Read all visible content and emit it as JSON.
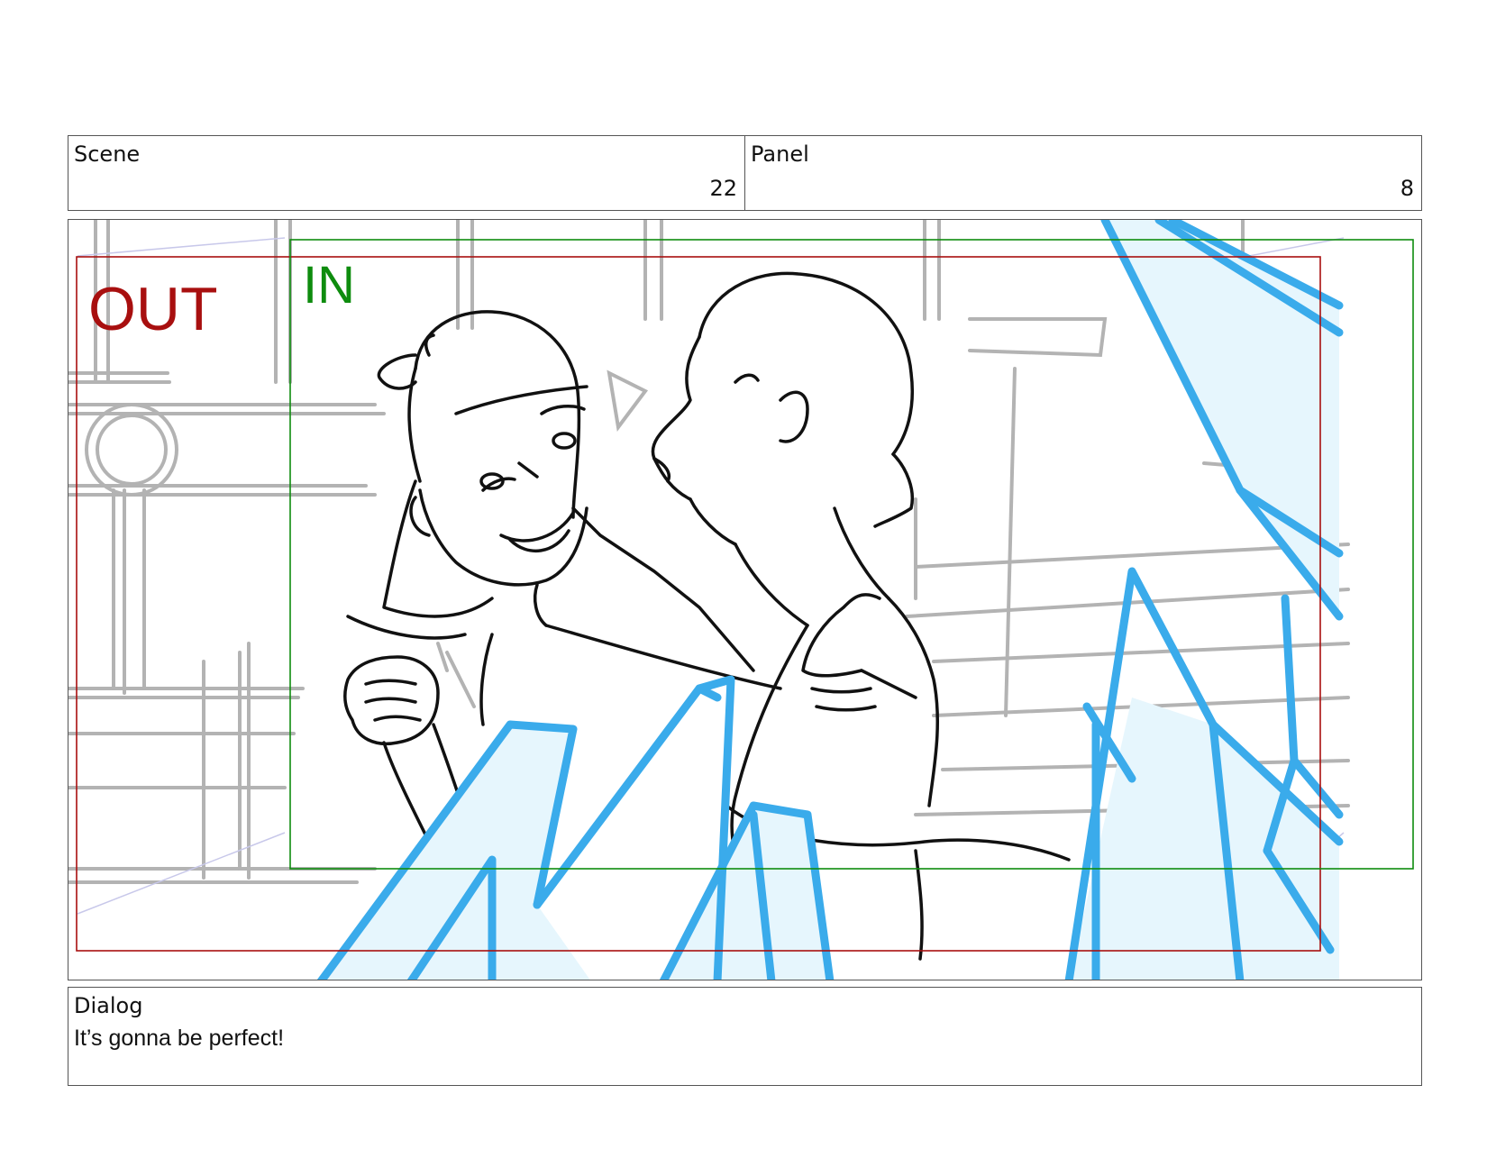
{
  "header": {
    "scene_label": "Scene",
    "scene_value": "22",
    "panel_label": "Panel",
    "panel_value": "8"
  },
  "frame": {
    "out_label": "OUT",
    "in_label": "IN",
    "colors": {
      "out": "#a80f0f",
      "in": "#0e8c0e",
      "ice": "#3aabeb",
      "ice_fill": "#e6f6fd",
      "background_sketch": "#b3b3b3",
      "ink": "#111111"
    }
  },
  "dialog": {
    "label": "Dialog",
    "text": "It’s gonna be perfect!"
  }
}
